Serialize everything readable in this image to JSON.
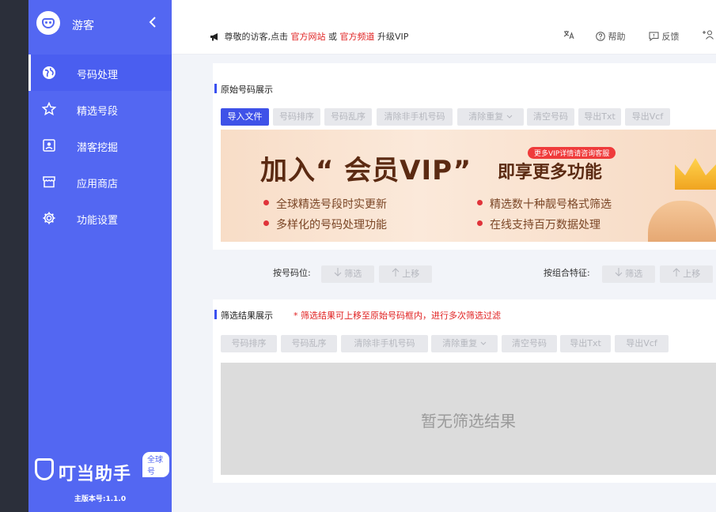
{
  "sidebar": {
    "user": "游客",
    "collapse_icon": "chevron-left-icon",
    "items": [
      {
        "label": "号码处理",
        "icon": "globe-icon",
        "active": true
      },
      {
        "label": "精选号段",
        "icon": "star-icon",
        "active": false
      },
      {
        "label": "潜客挖掘",
        "icon": "contact-card-icon",
        "active": false
      },
      {
        "label": "应用商店",
        "icon": "store-icon",
        "active": false
      },
      {
        "label": "功能设置",
        "icon": "gear-icon",
        "active": false
      }
    ],
    "brand_name": "叮当助手",
    "brand_badge": "全球号",
    "version": "主版本号:1.1.0"
  },
  "topbar": {
    "notice_prefix": "尊敬的访客,点击",
    "link_site": "官方网站",
    "notice_or": "或",
    "link_channel": "官方频道",
    "notice_suffix": "升级VIP",
    "translate_label": "",
    "help_label": "帮助",
    "feedback_label": "反馈",
    "add_user_label": ""
  },
  "original": {
    "title": "原始号码展示",
    "buttons": [
      "导入文件",
      "号码排序",
      "号码乱序",
      "清除非手机号码",
      "清除重复",
      "清空号码",
      "导出Txt",
      "导出Vcf"
    ]
  },
  "banner": {
    "title": "加入“ 会员VIP”",
    "subtitle": "即享更多功能",
    "pill": "更多VIP详情请咨询客服",
    "features": [
      "全球精选号段时实更新",
      "精选数十种靓号格式筛选",
      "多样化的号码处理功能",
      "在线支持百万数据处理"
    ]
  },
  "filters": {
    "by_position_label": "按号码位:",
    "by_combo_label": "按组合特征:",
    "filter_label": "筛选",
    "move_up_label": "上移"
  },
  "results": {
    "title": "筛选结果展示",
    "hint": "* 筛选结果可上移至原始号码框内，进行多次筛选过滤",
    "buttons": [
      "号码排序",
      "号码乱序",
      "清除非手机号码",
      "清除重复",
      "清空号码",
      "导出Txt",
      "导出Vcf"
    ],
    "empty_text": "暂无筛选结果"
  },
  "colors": {
    "sidebar": "#5367f2",
    "primary": "#3f52e8",
    "link_red": "#e02020"
  }
}
